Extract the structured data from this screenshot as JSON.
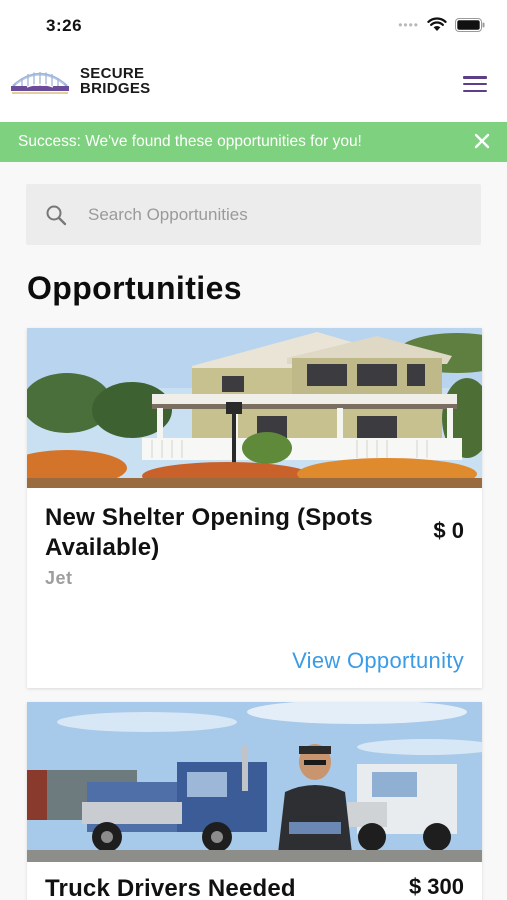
{
  "status_bar": {
    "time": "3:26"
  },
  "header": {
    "logo_line1": "SECURE",
    "logo_line2": "BRIDGES"
  },
  "alert": {
    "message": "Success: We've found these opportunities for you!"
  },
  "search": {
    "placeholder": "Search Opportunities"
  },
  "page": {
    "title": "Opportunities"
  },
  "opportunities": [
    {
      "title": "New Shelter Opening (Spots Available)",
      "price": "$ 0",
      "author": "Jet",
      "link_label": "View Opportunity",
      "image": "house-photo"
    },
    {
      "title": "Truck Drivers Needed",
      "price": "$ 300",
      "image": "trucks-photo"
    }
  ],
  "colors": {
    "success": "#7ed17e",
    "accent": "#3a9be6",
    "brand": "#5c3f86",
    "search_bg": "#ececec"
  }
}
